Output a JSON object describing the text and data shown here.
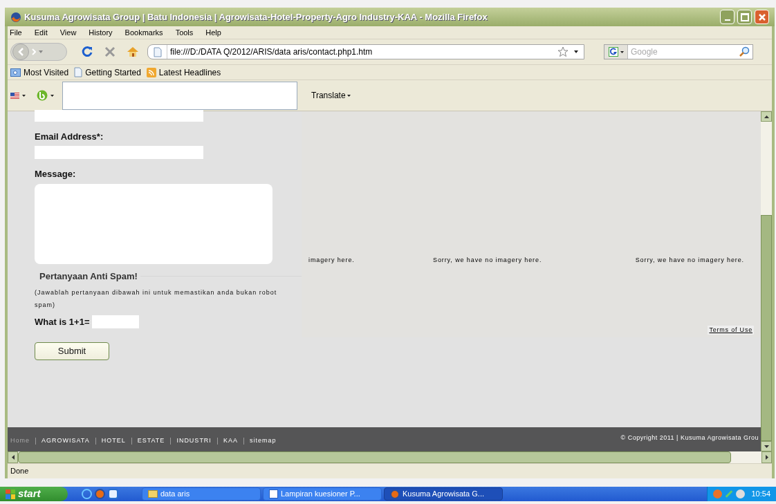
{
  "window": {
    "title": "Kusuma Agrowisata Group | Batu Indonesia | Agrowisata-Hotel-Property-Agro Industry-KAA - Mozilla Firefox"
  },
  "menu": [
    "File",
    "Edit",
    "View",
    "History",
    "Bookmarks",
    "Tools",
    "Help"
  ],
  "address_bar": {
    "value": "file:///D:/DATA Q/2012/ARIS/data aris/contact.php1.htm"
  },
  "search": {
    "placeholder": "Google"
  },
  "bookmarks": [
    {
      "label": "Most Visited",
      "kind": "folder"
    },
    {
      "label": "Getting Started",
      "kind": "page"
    },
    {
      "label": "Latest Headlines",
      "kind": "feed"
    }
  ],
  "translate_toolbar": {
    "label": "Translate"
  },
  "form": {
    "fields": [
      {
        "label": "Email Address*:",
        "kind": "line"
      },
      {
        "label": "Message:",
        "kind": "area"
      }
    ],
    "anti_spam": {
      "heading": "Pertanyaan Anti Spam!",
      "note": "(Jawablah pertanyaan dibawah ini untuk memastikan anda bukan robot spam)",
      "question": "What is 1+1="
    },
    "submit": "Submit"
  },
  "imagery": [
    "imagery here.",
    "Sorry, we have no imagery here.",
    "Sorry, we have no imagery here."
  ],
  "terms_link": "Terms of Use",
  "footer": {
    "nav": [
      {
        "label": "Home",
        "selected": true
      },
      {
        "label": "AGROWISATA",
        "selected": false
      },
      {
        "label": "HOTEL",
        "selected": false
      },
      {
        "label": "ESTATE",
        "selected": false
      },
      {
        "label": "INDUSTRI",
        "selected": false
      },
      {
        "label": "KAA",
        "selected": false
      },
      {
        "label": "sitemap",
        "selected": false
      }
    ],
    "copyright": "© Copyright 2011 | Kusuma Agrowisata Grou"
  },
  "status_bar": "Done",
  "taskbar": {
    "start": "start",
    "tasks": [
      {
        "label": "data aris",
        "kind": "folder",
        "selected": false
      },
      {
        "label": "Lampiran kuesioner P...",
        "kind": "document",
        "selected": false
      },
      {
        "label": "Kusuma Agrowisata G...",
        "kind": "browser",
        "selected": true
      }
    ],
    "clock": "10:54"
  }
}
